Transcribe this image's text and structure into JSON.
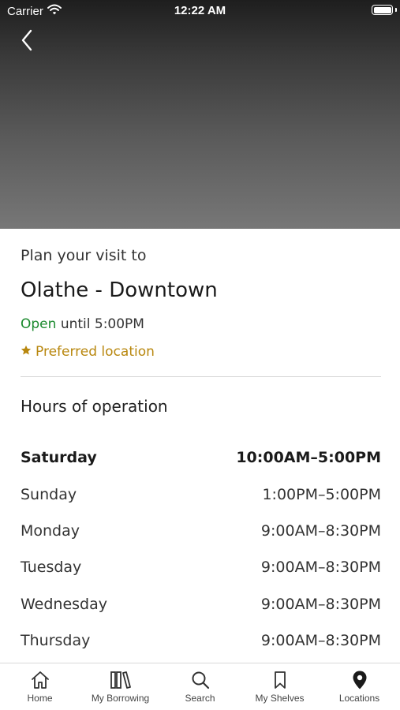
{
  "status_bar": {
    "carrier": "Carrier",
    "time": "12:22 AM"
  },
  "icons": {
    "back": "chevron-left-icon",
    "wifi": "wifi-icon",
    "battery": "battery-icon",
    "star": "star-icon",
    "tabs": [
      "home-icon",
      "books-icon",
      "search-icon",
      "bookmark-icon",
      "location-pin-icon"
    ]
  },
  "colors": {
    "open": "#1b8a2e",
    "preferred": "#b8870e",
    "hero_top": "#1e1e1e",
    "hero_bottom": "#777777"
  },
  "location": {
    "intro": "Plan your visit to",
    "name": "Olathe - Downtown",
    "open_status": "Open",
    "open_until": "until 5:00PM",
    "preferred": "Preferred location"
  },
  "hours": {
    "title": "Hours of operation",
    "rows": [
      {
        "day": "Saturday",
        "time": "10:00AM–5:00PM"
      },
      {
        "day": "Sunday",
        "time": "1:00PM–5:00PM"
      },
      {
        "day": "Monday",
        "time": "9:00AM–8:30PM"
      },
      {
        "day": "Tuesday",
        "time": "9:00AM–8:30PM"
      },
      {
        "day": "Wednesday",
        "time": "9:00AM–8:30PM"
      },
      {
        "day": "Thursday",
        "time": "9:00AM–8:30PM"
      }
    ]
  },
  "tabs": [
    {
      "label": "Home"
    },
    {
      "label": "My Borrowing"
    },
    {
      "label": "Search"
    },
    {
      "label": "My Shelves"
    },
    {
      "label": "Locations"
    }
  ]
}
